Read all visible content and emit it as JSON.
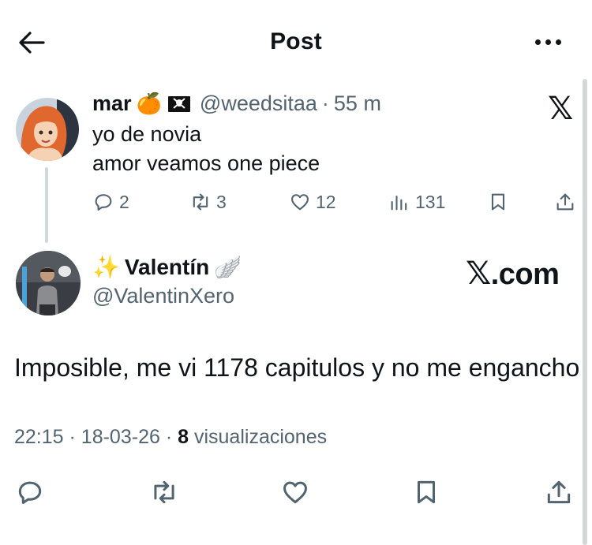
{
  "header": {
    "title": "Post"
  },
  "quoted_tweet": {
    "name": "mar",
    "name_emojis": [
      "🍊",
      "🏴‍☠️"
    ],
    "handle": "@weedsitaa",
    "separator": "·",
    "time": "55 m",
    "text_line1": "yo de novia",
    "text_line2": "amor veamos one piece",
    "actions": {
      "replies": "2",
      "reposts": "3",
      "likes": "12",
      "views": "131"
    },
    "watermark_icon": "x-logo-icon"
  },
  "main_tweet": {
    "name_prefix_emoji": "✨",
    "name": "Valentín",
    "name_suffix_emoji": "🪽",
    "handle": "@ValentinXero",
    "watermark": ".com",
    "text": "Imposible, me vi 1178 capitulos y no me engancho",
    "meta": {
      "time": "22:15",
      "separator1": "·",
      "date": "18-03-26",
      "separator2": "·",
      "views_count": "8",
      "views_label": "visualizaciones"
    }
  },
  "colors": {
    "text": "#0f1419",
    "secondary": "#536471",
    "thread_line": "#cfd9de",
    "background": "#ffffff"
  }
}
